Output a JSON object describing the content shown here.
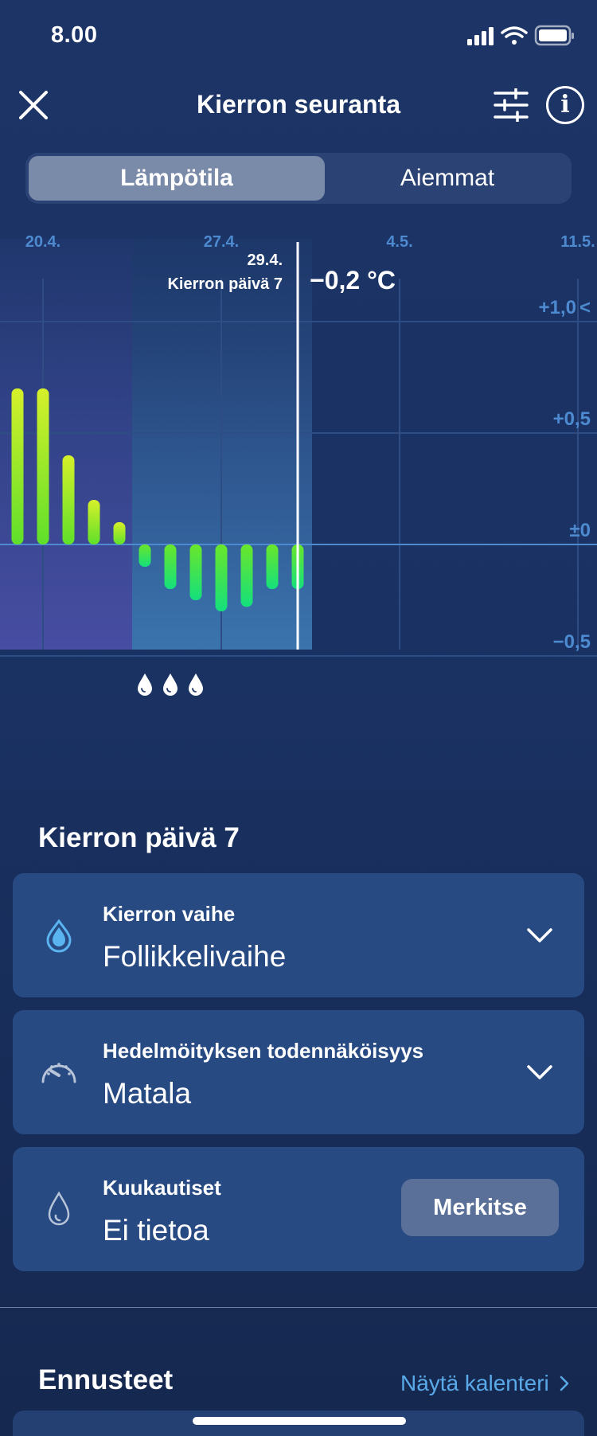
{
  "status_bar": {
    "time": "8.00",
    "icons": [
      "signal-icon",
      "wifi-icon",
      "battery-icon"
    ]
  },
  "header": {
    "title": "Kierron seuranta",
    "icons": [
      "close-icon",
      "filter-icon",
      "info-icon"
    ]
  },
  "info_glyph": "i",
  "tabs": [
    {
      "label": "Lämpötila",
      "selected": true
    },
    {
      "label": "Aiemmat",
      "selected": false
    }
  ],
  "chart_data": {
    "type": "bar",
    "x_ticks": [
      "20.4.",
      "27.4.",
      "4.5.",
      "11.5."
    ],
    "y_ticks": [
      "+1,0",
      "+0,5",
      "±0",
      "−0,5"
    ],
    "y_tick_values": [
      1.0,
      0.5,
      0,
      -0.5
    ],
    "y_limit_marker": "<",
    "ylim": [
      -0.9,
      1.2
    ],
    "selected": {
      "date": "29.4.",
      "label": "Kierron päivä 7",
      "value": "−0,2 °C"
    },
    "values": [
      0.7,
      0.7,
      0.4,
      0.2,
      0.1,
      -0.1,
      -0.2,
      -0.25,
      -0.3,
      -0.28,
      -0.2,
      -0.2
    ],
    "drops_count": 3,
    "colors": {
      "positive_top": "#d6f02a",
      "negative_bottom": "#14e07d",
      "grid": "#2e4d84",
      "axis": "#4d8ad0"
    }
  },
  "section": {
    "title": "Kierron päivä 7"
  },
  "cards": [
    {
      "label": "Kierron vaihe",
      "value": "Follikkelivaihe",
      "icon": "drop-icon"
    },
    {
      "label": "Hedelmöityksen todennäköisyys",
      "value": "Matala",
      "icon": "gauge-icon"
    },
    {
      "label": "Kuukautiset",
      "value": "Ei tietoa",
      "icon": "drop-outline-icon",
      "button": "Merkitse"
    }
  ],
  "forecast": {
    "title": "Ennusteet",
    "link": "Näytä kalenteri"
  }
}
